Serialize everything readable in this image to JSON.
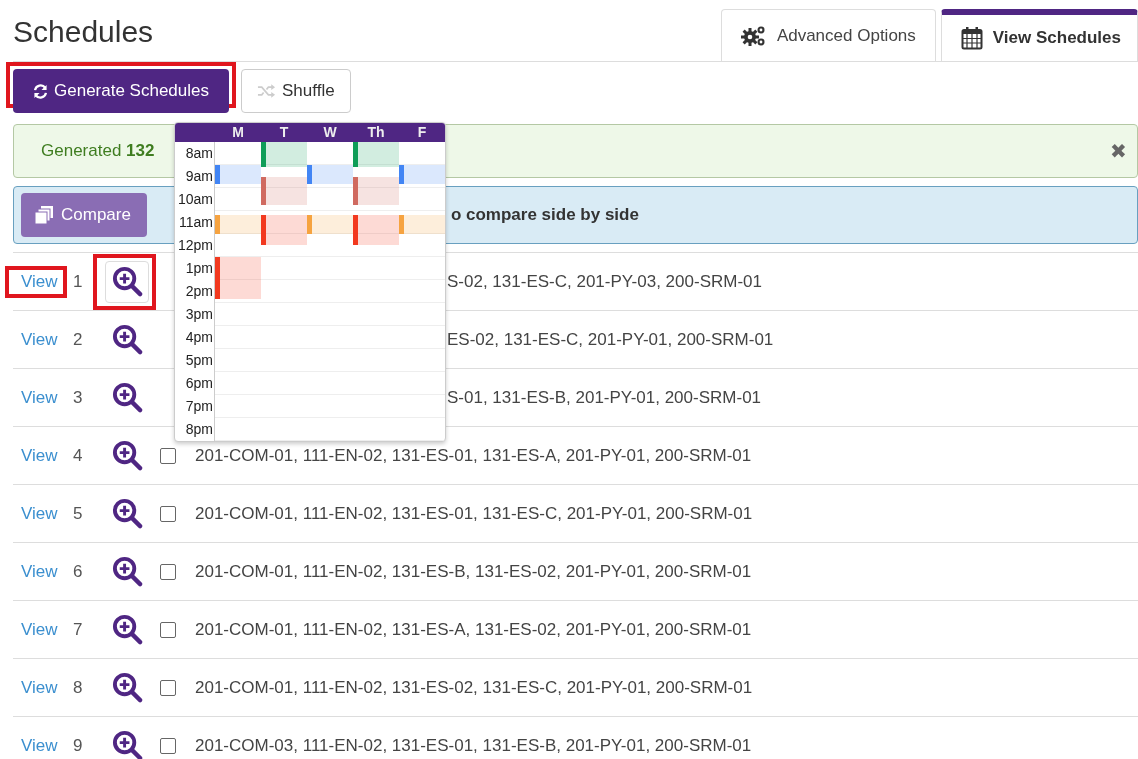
{
  "title": "Schedules",
  "tabs": [
    {
      "label": "Advanced Options",
      "selected": false
    },
    {
      "label": "View Schedules",
      "selected": true
    }
  ],
  "toolbar": [
    {
      "label": "Generate Schedules",
      "kind": "primary",
      "highlighted": true
    },
    {
      "label": "Shuffle",
      "kind": "secondary",
      "highlighted": false
    }
  ],
  "success_alert": {
    "text": "Generated **132**",
    "close": "✖"
  },
  "info_alert": {
    "button": "Compare",
    "text": "o compare side by side"
  },
  "preview": {
    "days": [
      "M",
      "T",
      "W",
      "Th",
      "F"
    ],
    "hours": [
      "8am",
      "9am",
      "10am",
      "11am",
      "12pm",
      "1pm",
      "2pm",
      "3pm",
      "4pm",
      "5pm",
      "6pm",
      "7pm",
      "8pm"
    ],
    "events": [
      {
        "color": "#0f9d58"
      },
      {
        "color": "#4285f4"
      },
      {
        "color": "#d06a60"
      },
      {
        "color": "#f6a340"
      },
      {
        "color": "#f2391f"
      },
      {
        "color": "#f2391f"
      }
    ]
  },
  "rows": [
    {
      "link": "View",
      "number": "1",
      "link_highlighted": true,
      "zoom_highlighted": true,
      "kind": "covered",
      "text": "S-02, 131-ES-C, 201-PY-03, 200-SRM-01"
    },
    {
      "link": "View",
      "number": "2",
      "link_highlighted": false,
      "zoom_highlighted": false,
      "kind": "covered",
      "text": "ES-02, 131-ES-C, 201-PY-01, 200-SRM-01"
    },
    {
      "link": "View",
      "number": "3",
      "link_highlighted": false,
      "zoom_highlighted": false,
      "kind": "covered",
      "text": "S-01, 131-ES-B, 201-PY-01, 200-SRM-01"
    },
    {
      "link": "View",
      "number": "4",
      "link_highlighted": false,
      "zoom_highlighted": false,
      "kind": "full",
      "checked": false,
      "text": "201-COM-01, 111-EN-02, 131-ES-01, 131-ES-A, 201-PY-01, 200-SRM-01"
    },
    {
      "link": "View",
      "number": "5",
      "link_highlighted": false,
      "zoom_highlighted": false,
      "kind": "full",
      "checked": false,
      "text": "201-COM-01, 111-EN-02, 131-ES-01, 131-ES-C, 201-PY-01, 200-SRM-01"
    },
    {
      "link": "View",
      "number": "6",
      "link_highlighted": false,
      "zoom_highlighted": false,
      "kind": "full",
      "checked": false,
      "text": "201-COM-01, 111-EN-02, 131-ES-B, 131-ES-02, 201-PY-01, 200-SRM-01"
    },
    {
      "link": "View",
      "number": "7",
      "link_highlighted": false,
      "zoom_highlighted": false,
      "kind": "full",
      "checked": false,
      "text": "201-COM-01, 111-EN-02, 131-ES-A, 131-ES-02, 201-PY-01, 200-SRM-01"
    },
    {
      "link": "View",
      "number": "8",
      "link_highlighted": false,
      "zoom_highlighted": false,
      "kind": "full",
      "checked": false,
      "text": "201-COM-01, 111-EN-02, 131-ES-02, 131-ES-C, 201-PY-01, 200-SRM-01"
    },
    {
      "link": "View",
      "number": "9",
      "link_highlighted": false,
      "zoom_highlighted": false,
      "kind": "full",
      "checked": false,
      "text": "201-COM-03, 111-EN-02, 131-ES-01, 131-ES-B, 201-PY-01, 200-SRM-01"
    }
  ]
}
